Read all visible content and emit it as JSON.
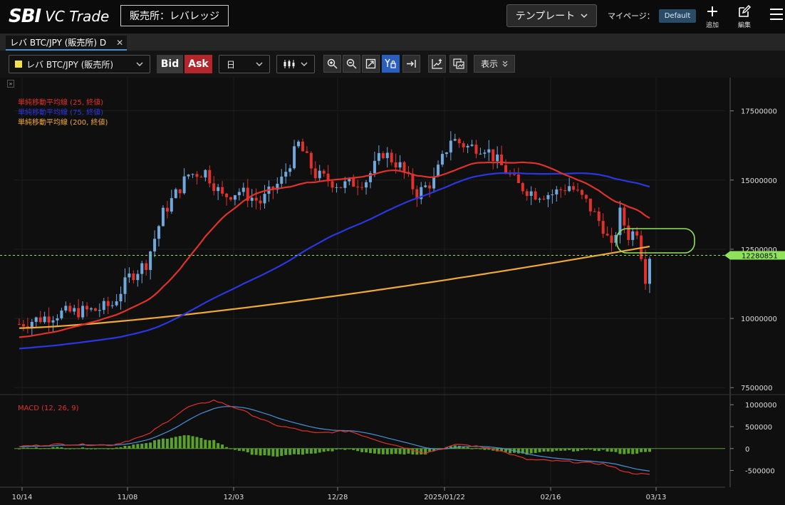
{
  "header": {
    "logo_sbi": "SBI",
    "logo_vc": "VC Trade",
    "exchange": "販売所：レバレッジ",
    "template_label": "テンプレート",
    "mypage_label": "マイページ：",
    "mypage_value": "Default",
    "add_label": "追加",
    "edit_label": "編集"
  },
  "tab": {
    "label": "レバ BTC/JPY (販売所) D"
  },
  "toolbar": {
    "symbol": "レバ BTC/JPY (販売所)",
    "symbol_color": "#f3e24a",
    "bid_label": "Bid",
    "ask_label": "Ask",
    "timeframe": "日",
    "display_label": "表示",
    "tools": [
      "zoom-in-icon",
      "zoom-out-icon",
      "fit-icon",
      "y-lock-icon",
      "jump-to-latest-icon",
      "add-indicator-icon",
      "compare-icon"
    ]
  },
  "legend": [
    {
      "text": "単純移動平均線 (25, 終値)",
      "color": "#e0322a"
    },
    {
      "text": "単純移動平均線 (75, 終値)",
      "color": "#2a37e0"
    },
    {
      "text": "単純移動平均線 (200, 終値)",
      "color": "#f1a83a"
    }
  ],
  "chart_data": {
    "type": "candlestick",
    "up_color": "#6fa8dc",
    "down_color": "#e0322a",
    "y_axis_labels": [
      "17500000",
      "15000000",
      "12500000",
      "10000000",
      "7500000"
    ],
    "y_axis_values": [
      17500000,
      15000000,
      12500000,
      10000000,
      7500000
    ],
    "ylim": [
      7300000,
      18700000
    ],
    "current_price_label": "12280851",
    "current_price": 12280851,
    "x_labels": [
      "10/14",
      "11/08",
      "12/03",
      "12/28",
      "2025/01/22",
      "02/16",
      "03/13"
    ],
    "macd": {
      "label": "MACD (12, 26, 9)",
      "y_axis_labels": [
        "1000000",
        "500000",
        "0",
        "-500000"
      ],
      "y_axis_values": [
        1000000,
        500000,
        0,
        -500000
      ],
      "ylim": [
        -800000,
        1150000
      ],
      "macd_color": "#e0322a",
      "signal_color": "#4a90d9",
      "hist_color": "#5aa02c"
    }
  }
}
